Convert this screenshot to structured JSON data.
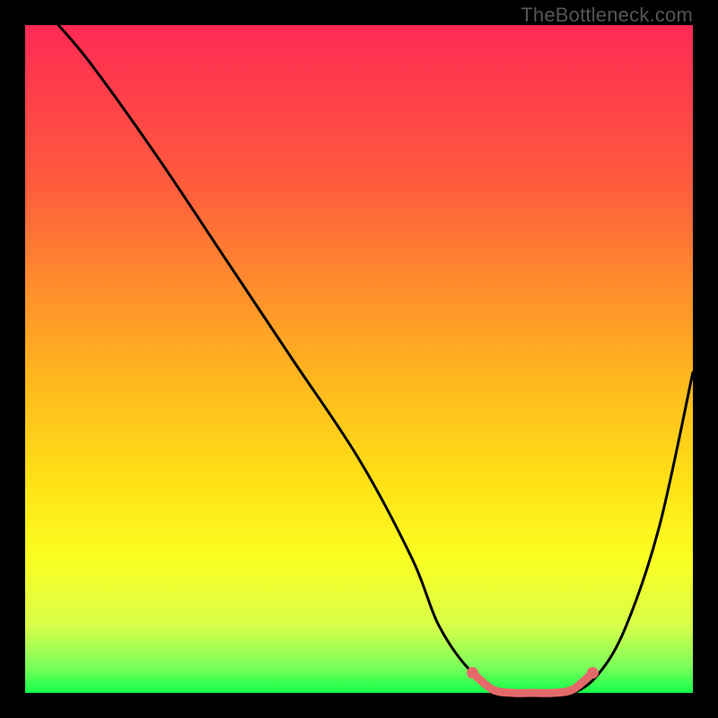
{
  "watermark": "TheBottleneck.com",
  "chart_data": {
    "type": "line",
    "title": "",
    "xlabel": "",
    "ylabel": "",
    "xlim": [
      0,
      100
    ],
    "ylim": [
      0,
      100
    ],
    "grid": false,
    "legend": false,
    "series": [
      {
        "name": "bottleneck-curve",
        "color": "#000000",
        "x": [
          5,
          10,
          20,
          30,
          40,
          50,
          58,
          62,
          67,
          72,
          77,
          82,
          86,
          90,
          95,
          100
        ],
        "y": [
          100,
          94,
          80,
          65,
          50,
          35,
          20,
          10,
          3,
          0,
          0,
          0,
          3,
          10,
          25,
          48
        ]
      },
      {
        "name": "marker-segment",
        "color": "#e46a6a",
        "x": [
          67,
          70,
          73,
          76,
          79,
          82,
          85
        ],
        "y": [
          3,
          0.5,
          0,
          0,
          0,
          0.5,
          3
        ]
      }
    ],
    "annotations": [
      {
        "text": "TheBottleneck.com",
        "position": "top-right"
      }
    ]
  }
}
